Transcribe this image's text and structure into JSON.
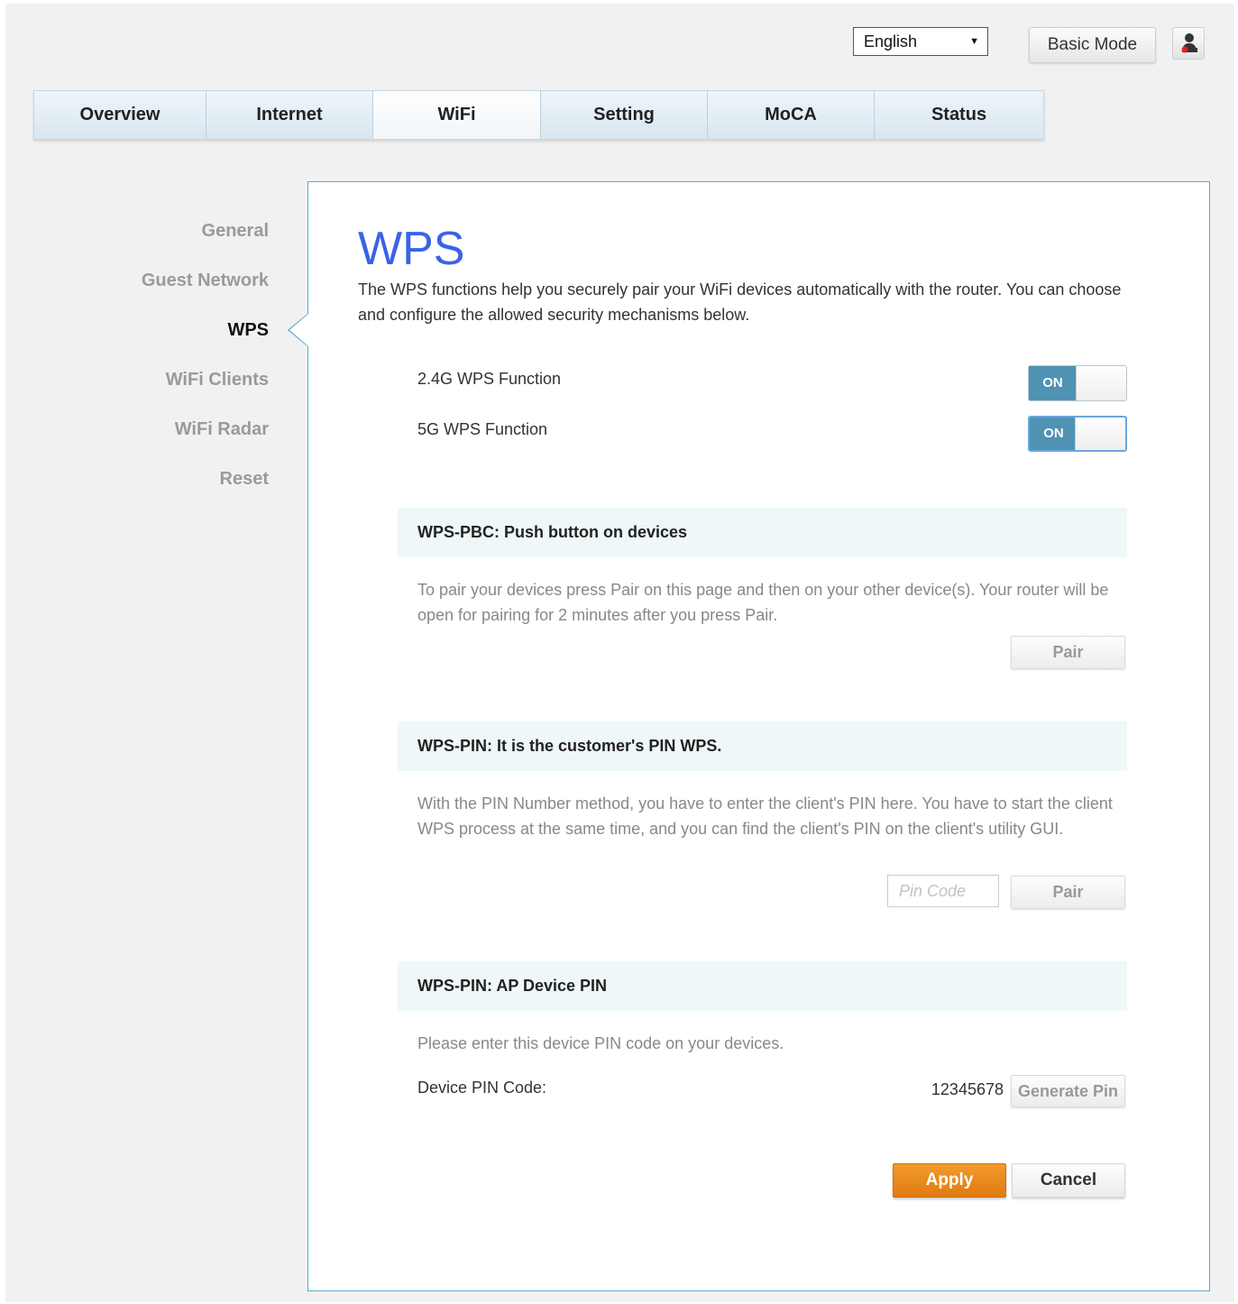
{
  "header": {
    "language": {
      "selected": "English"
    },
    "basic_mode_label": "Basic Mode",
    "user_icon": "user-icon"
  },
  "nav": {
    "tabs": [
      {
        "label": "Overview"
      },
      {
        "label": "Internet"
      },
      {
        "label": "WiFi",
        "active": true
      },
      {
        "label": "Setting"
      },
      {
        "label": "MoCA"
      },
      {
        "label": "Status"
      }
    ]
  },
  "sidebar": {
    "items": [
      {
        "label": "General"
      },
      {
        "label": "Guest Network"
      },
      {
        "label": "WPS",
        "active": true
      },
      {
        "label": "WiFi Clients"
      },
      {
        "label": "WiFi Radar"
      },
      {
        "label": "Reset"
      }
    ]
  },
  "main": {
    "title": "WPS",
    "intro": "The WPS functions help you securely pair your WiFi devices automatically with the router. You can choose and configure the allowed security mechanisms below.",
    "functions": [
      {
        "label": "2.4G WPS Function",
        "state": "ON"
      },
      {
        "label": "5G WPS Function",
        "state": "ON"
      }
    ],
    "pbc": {
      "heading": "WPS-PBC: Push button on devices",
      "text": "To pair your devices press Pair on this page and then on your other device(s). Your router will be open for pairing for 2 minutes after you press Pair.",
      "pair_label": "Pair"
    },
    "pin": {
      "heading": "WPS-PIN: It is the customer's PIN WPS.",
      "text": "With the PIN Number method, you have to enter the client's PIN here. You have to start the client WPS process at the same time, and you can find the client's PIN on the client's utility GUI.",
      "input_placeholder": "Pin Code",
      "input_value": "",
      "pair_label": "Pair"
    },
    "ap_pin": {
      "heading": "WPS-PIN: AP Device PIN",
      "text": "Please enter this device PIN code on your devices.",
      "pin_label": "Device PIN Code:",
      "pin_value": "12345678",
      "generate_label": "Generate Pin"
    },
    "apply_label": "Apply",
    "cancel_label": "Cancel"
  },
  "colors": {
    "title_blue": "#3a63e6",
    "toggle_on": "#4f92b3",
    "panel_border": "#5aa9d0",
    "apply_orange": "#e88a1f",
    "section_bg": "#eef8f9"
  }
}
